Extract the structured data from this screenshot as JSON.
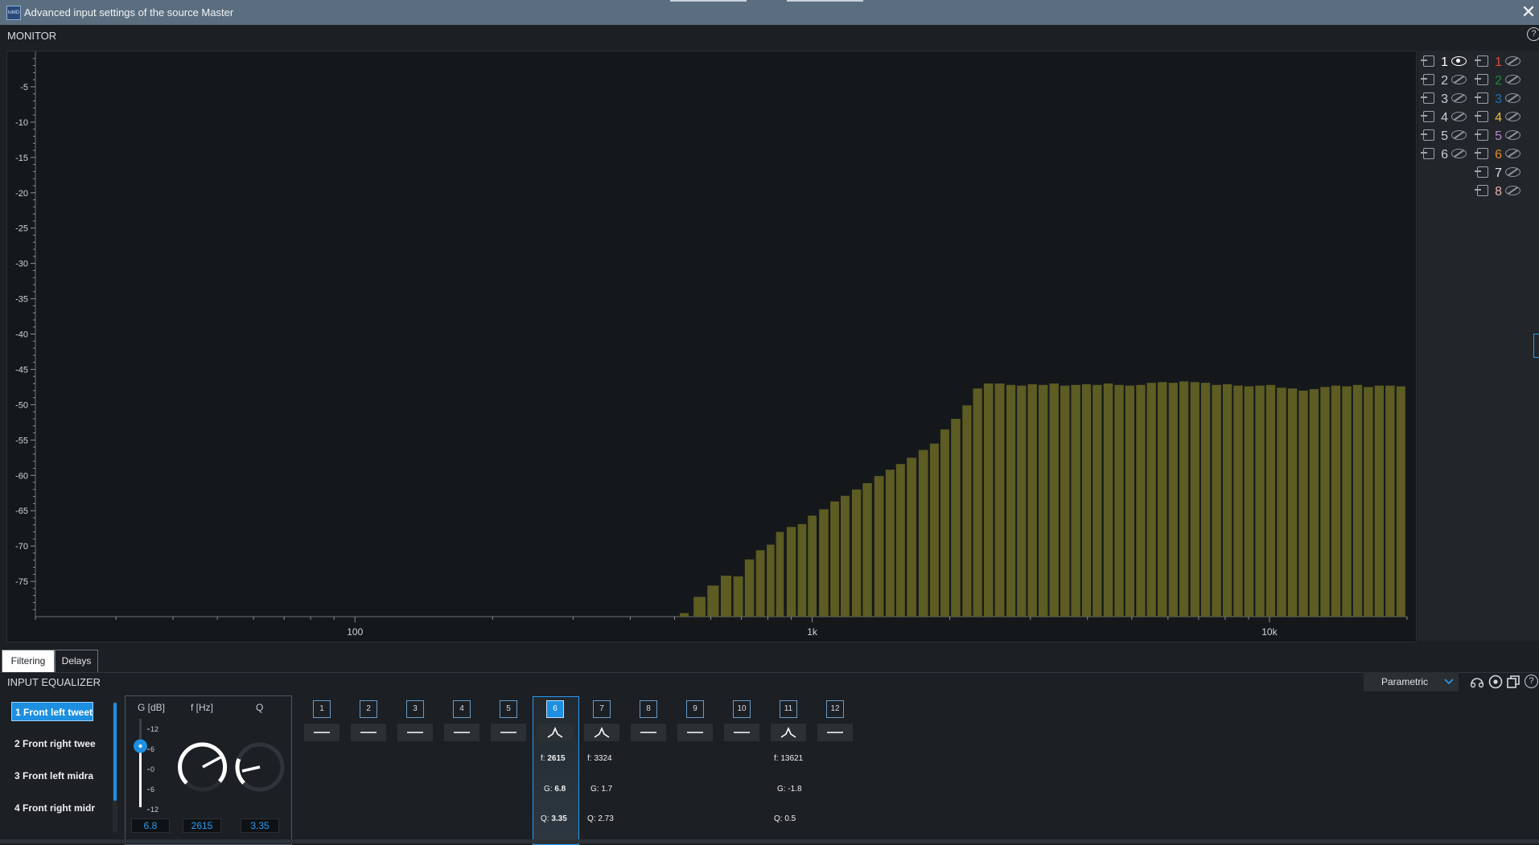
{
  "window": {
    "title": "Advanced input settings of the source Master",
    "logo_text": "toMD",
    "close_label": "✕"
  },
  "monitor": {
    "label": "MONITOR",
    "help": "?"
  },
  "chart_data": {
    "type": "bar",
    "x_scale": "log",
    "xlim": [
      20,
      20000
    ],
    "ylim": [
      -80,
      0
    ],
    "y_ticks": [
      -5,
      -10,
      -15,
      -20,
      -25,
      -30,
      -35,
      -40,
      -45,
      -50,
      -55,
      -60,
      -65,
      -70,
      -75
    ],
    "x_tick_labels": [
      {
        "value": 100,
        "label": "100"
      },
      {
        "value": 1000,
        "label": "1k"
      },
      {
        "value": 10000,
        "label": "10k"
      }
    ],
    "bar_color": "#5c5c23",
    "x": [
      525,
      567,
      607,
      648,
      689,
      729,
      770,
      811,
      850,
      900,
      950,
      1000,
      1060,
      1120,
      1180,
      1250,
      1320,
      1400,
      1480,
      1560,
      1650,
      1750,
      1850,
      1950,
      2060,
      2180,
      2300,
      2430,
      2570,
      2720,
      2870,
      3030,
      3200,
      3380,
      3570,
      3770,
      3980,
      4200,
      4440,
      4690,
      4950,
      5230,
      5520,
      5830,
      6160,
      6500,
      6870,
      7250,
      7660,
      8090,
      8540,
      9020,
      9530,
      10060,
      10630,
      11230,
      11860,
      12520,
      13230,
      13970,
      14760,
      15590,
      16460,
      17380,
      18360,
      19390
    ],
    "values": [
      -79.5,
      -77.2,
      -75.6,
      -74.2,
      -74.3,
      -71.9,
      -70.6,
      -69.8,
      -68.0,
      -67.3,
      -66.9,
      -65.7,
      -64.8,
      -63.7,
      -62.9,
      -62.0,
      -61.1,
      -60.1,
      -59.2,
      -58.4,
      -57.5,
      -56.4,
      -55.5,
      -53.5,
      -52.0,
      -50.1,
      -47.7,
      -47.0,
      -47.0,
      -47.2,
      -47.3,
      -47.1,
      -47.2,
      -47.0,
      -47.3,
      -47.2,
      -47.1,
      -47.2,
      -47.0,
      -47.2,
      -47.3,
      -47.2,
      -46.9,
      -46.8,
      -46.9,
      -46.7,
      -46.8,
      -46.9,
      -47.2,
      -47.1,
      -47.3,
      -47.4,
      -47.3,
      -47.2,
      -47.6,
      -47.7,
      -48.0,
      -47.8,
      -47.5,
      -47.3,
      -47.4,
      -47.2,
      -47.5,
      -47.3,
      -47.3,
      -47.4
    ]
  },
  "legend": {
    "inputs": [
      {
        "n": "1",
        "visible": true
      },
      {
        "n": "2",
        "visible": false
      },
      {
        "n": "3",
        "visible": false
      },
      {
        "n": "4",
        "visible": false
      },
      {
        "n": "5",
        "visible": false
      },
      {
        "n": "6",
        "visible": false
      }
    ],
    "outputs": [
      {
        "n": "1",
        "color": "#e04a3a"
      },
      {
        "n": "2",
        "color": "#1f8a3a"
      },
      {
        "n": "3",
        "color": "#1f6fb8"
      },
      {
        "n": "4",
        "color": "#e8c23a"
      },
      {
        "n": "5",
        "color": "#b78ac8"
      },
      {
        "n": "6",
        "color": "#e08a2a"
      },
      {
        "n": "7",
        "color": "#dfe6ec"
      },
      {
        "n": "8",
        "color": "#e8b0b0"
      }
    ]
  },
  "tabs": [
    {
      "label": "Filtering",
      "active": true
    },
    {
      "label": "Delays",
      "active": false
    }
  ],
  "eq": {
    "label": "INPUT EQUALIZER",
    "mode": "Parametric",
    "channels": [
      "1  Front left tweet",
      "2  Front right twee",
      "3  Front left midra",
      "4  Front right midr"
    ],
    "params": {
      "g_label": "G [dB]",
      "f_label": "f [Hz]",
      "q_label": "Q",
      "g_value": "6.8",
      "f_value": "2615",
      "q_value": "3.35",
      "slider_ticks": [
        "12",
        "6",
        "0",
        "6",
        "12"
      ]
    },
    "bands": [
      {
        "n": "1",
        "shape": "flat"
      },
      {
        "n": "2",
        "shape": "flat"
      },
      {
        "n": "3",
        "shape": "flat"
      },
      {
        "n": "4",
        "shape": "flat"
      },
      {
        "n": "5",
        "shape": "flat"
      },
      {
        "n": "6",
        "shape": "peak",
        "f": "2615",
        "g": "6.8",
        "q": "3.35"
      },
      {
        "n": "7",
        "shape": "peak",
        "f": "3324",
        "g": "1.7",
        "q": "2.73"
      },
      {
        "n": "8",
        "shape": "flat"
      },
      {
        "n": "9",
        "shape": "flat"
      },
      {
        "n": "10",
        "shape": "flat"
      },
      {
        "n": "11",
        "shape": "peak",
        "f": "13621",
        "g": "-1.8",
        "q": "0.5"
      },
      {
        "n": "12",
        "shape": "flat"
      }
    ],
    "labels": {
      "f": "f:",
      "g": "G:",
      "q": "Q:"
    }
  }
}
